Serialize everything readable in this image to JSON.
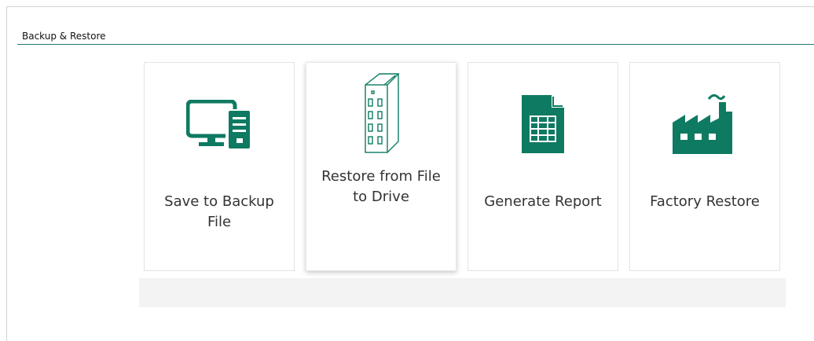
{
  "section": {
    "title": "Backup & Restore"
  },
  "accent_color": "#0e7a62",
  "cards": [
    {
      "label": "Save to Backup File",
      "icon": "computer-server-icon"
    },
    {
      "label": "Restore from File to Drive",
      "icon": "drive-icon"
    },
    {
      "label": "Generate Report",
      "icon": "report-document-icon"
    },
    {
      "label": "Factory Restore",
      "icon": "factory-icon"
    }
  ]
}
